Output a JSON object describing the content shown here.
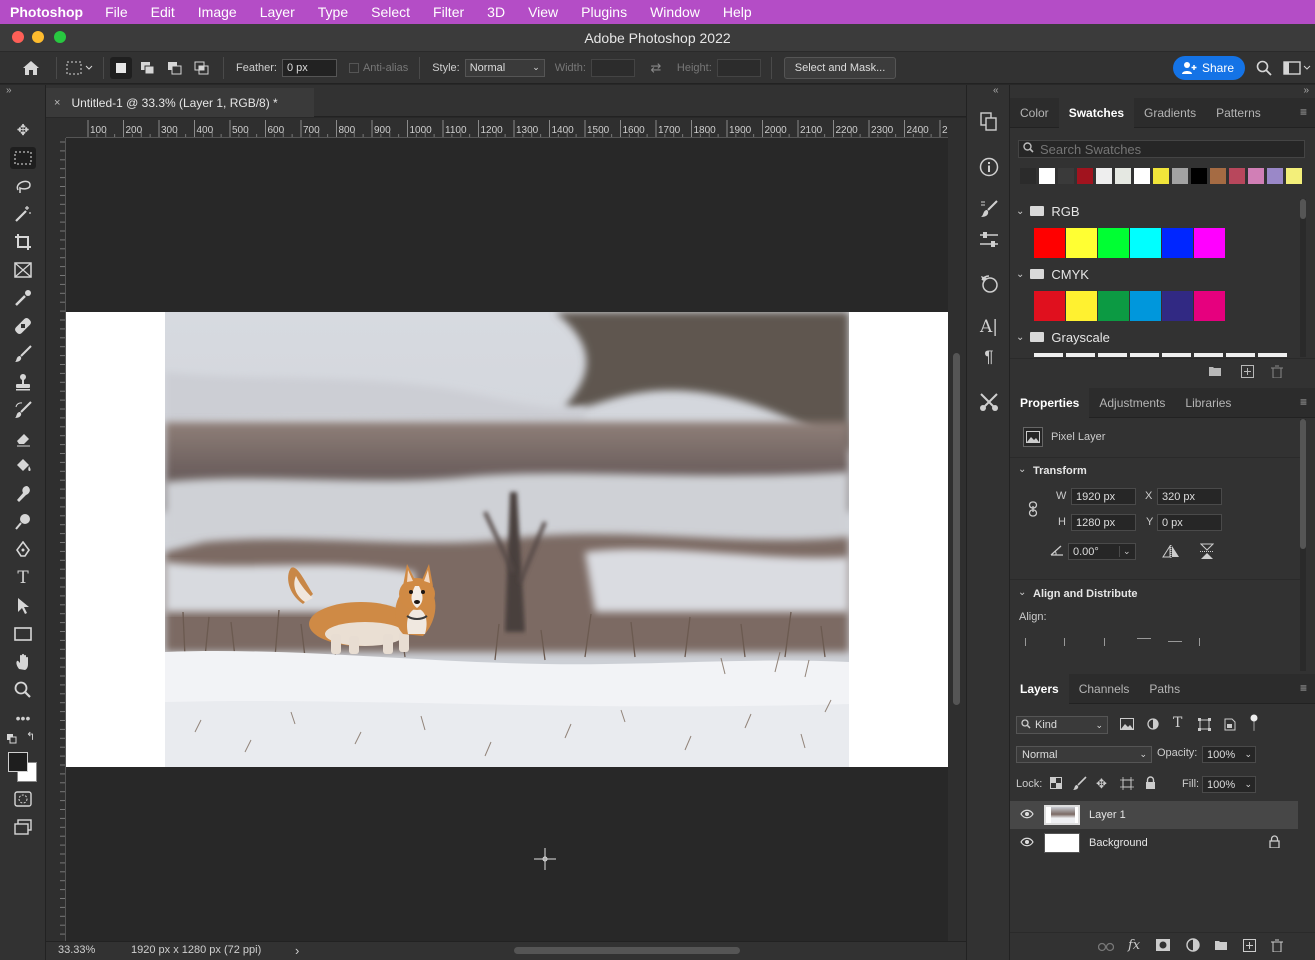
{
  "menubar": {
    "app": "Photoshop",
    "items": [
      "File",
      "Edit",
      "Image",
      "Layer",
      "Type",
      "Select",
      "Filter",
      "3D",
      "View",
      "Plugins",
      "Window",
      "Help"
    ]
  },
  "window": {
    "title": "Adobe Photoshop 2022"
  },
  "options": {
    "feather_label": "Feather:",
    "feather_value": "0 px",
    "antialias_label": "Anti-alias",
    "style_label": "Style:",
    "style_value": "Normal",
    "width_label": "Width:",
    "height_label": "Height:",
    "select_mask_label": "Select and Mask...",
    "share_label": "Share"
  },
  "document": {
    "tab_title": "Untitled-1 @ 33.3% (Layer 1, RGB/8) *",
    "close": "×"
  },
  "ruler": {
    "ticks": [
      "100",
      "200",
      "300",
      "400",
      "500",
      "600",
      "700",
      "800",
      "900",
      "1000",
      "1100",
      "1200",
      "1300",
      "1400",
      "1500",
      "1600",
      "1700",
      "1800",
      "1900",
      "2000",
      "2100",
      "2200",
      "2300",
      "2400",
      "2"
    ]
  },
  "status": {
    "zoom": "33.33%",
    "info": "1920 px x 1280 px (72 ppi)",
    "arrow": "›"
  },
  "swatches_panel": {
    "tabs": [
      "Color",
      "Swatches",
      "Gradients",
      "Patterns"
    ],
    "active_tab": "Swatches",
    "search_placeholder": "Search Swatches",
    "recent": [
      "#2b2b2b",
      "#ffffff",
      "#3a3a3a",
      "#a1131e",
      "#eeeeee",
      "#e5e8e2",
      "#ffffff",
      "#f1e53a",
      "#a3a3a3",
      "#000000",
      "#a56b43",
      "#b8475c",
      "#d17fb6",
      "#9a88c8",
      "#f3ef7a"
    ],
    "groups": [
      {
        "name": "RGB",
        "colors": [
          "#ff0000",
          "#ffff33",
          "#00ff33",
          "#00ffff",
          "#0026ff",
          "#ff00ff"
        ]
      },
      {
        "name": "CMYK",
        "colors": [
          "#e0101e",
          "#fff130",
          "#0c9a43",
          "#0097dc",
          "#312983",
          "#e6007e"
        ]
      },
      {
        "name": "Grayscale",
        "colors": []
      }
    ]
  },
  "properties_panel": {
    "tabs": [
      "Properties",
      "Adjustments",
      "Libraries"
    ],
    "active_tab": "Properties",
    "kind": "Pixel Layer",
    "transform_title": "Transform",
    "w_label": "W",
    "w_value": "1920 px",
    "h_label": "H",
    "h_value": "1280 px",
    "x_label": "X",
    "x_value": "320 px",
    "y_label": "Y",
    "y_value": "0 px",
    "angle_value": "0.00°",
    "align_title": "Align and Distribute",
    "align_label": "Align:"
  },
  "layers_panel": {
    "tabs": [
      "Layers",
      "Channels",
      "Paths"
    ],
    "active_tab": "Layers",
    "kind_label": "Kind",
    "blend_mode": "Normal",
    "opacity_label": "Opacity:",
    "opacity_value": "100%",
    "lock_label": "Lock:",
    "fill_label": "Fill:",
    "fill_value": "100%",
    "layers": [
      {
        "name": "Layer 1",
        "selected": true,
        "locked": false
      },
      {
        "name": "Background",
        "selected": false,
        "locked": true
      }
    ]
  },
  "colors": {
    "menubar": "#b44dc6",
    "share": "#1473e6"
  }
}
